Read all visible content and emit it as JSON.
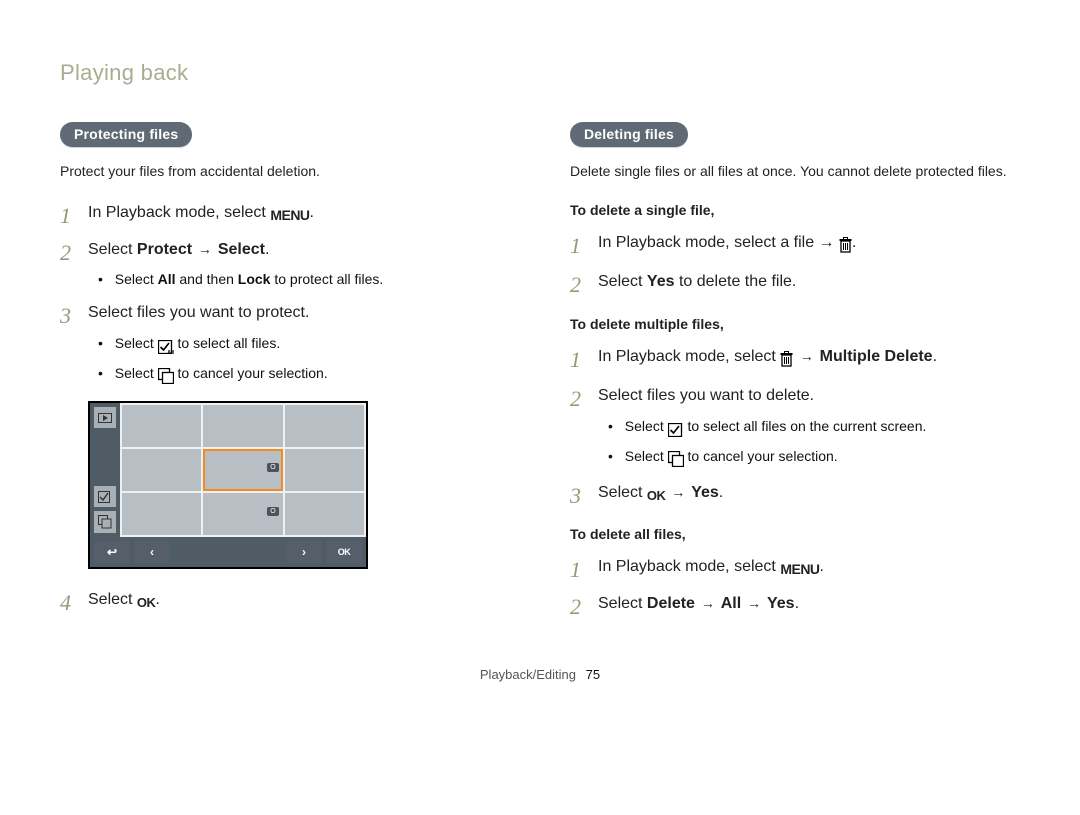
{
  "runningHead": "Playing back",
  "footer": {
    "section": "Playback/Editing",
    "page": "75"
  },
  "left": {
    "pill": "Protecting files",
    "intro": "Protect your files from accidental deletion.",
    "step1": "In Playback mode, select ",
    "step2_pre": "Select ",
    "step2_b1": "Protect",
    "step2_mid": " → ",
    "step2_b2": "Select",
    "step2_post": ".",
    "step2_sub_pre": "Select ",
    "step2_sub_b1": "All",
    "step2_sub_mid": " and then ",
    "step2_sub_b2": "Lock",
    "step2_sub_post": " to protect all files.",
    "step3": "Select files you want to protect.",
    "step3_sub1_pre": "Select ",
    "step3_sub1_post": " to select all files.",
    "step3_sub2_pre": "Select ",
    "step3_sub2_post": " to cancel your selection.",
    "step4_pre": "Select ",
    "step4_post": ".",
    "thumbKey": "O"
  },
  "right": {
    "pill": "Deleting files",
    "intro": "Delete single files or all files at once. You cannot delete protected files.",
    "hSingle": "To delete a single file,",
    "s1_step1_pre": "In Playback mode, select a file → ",
    "s1_step1_post": ".",
    "s1_step2_pre": "Select ",
    "s1_step2_b": "Yes",
    "s1_step2_post": " to delete the file.",
    "hMulti": "To delete multiple files,",
    "m_step1_pre": "In Playback mode, select ",
    "m_step1_mid": " → ",
    "m_step1_b": "Multiple Delete",
    "m_step1_post": ".",
    "m_step2": "Select files you want to delete.",
    "m_step2_sub1_pre": "Select ",
    "m_step2_sub1_post": " to select all files on the current screen.",
    "m_step2_sub2_pre": "Select ",
    "m_step2_sub2_post": " to cancel your selection.",
    "m_step3_pre": "Select ",
    "m_step3_mid": " → ",
    "m_step3_b": "Yes",
    "m_step3_post": ".",
    "hAll": "To delete all files,",
    "a_step1": "In Playback mode, select ",
    "a_step2_pre": "Select ",
    "a_step2_b1": "Delete",
    "a_step2_m1": " → ",
    "a_step2_b2": "All",
    "a_step2_m2": " → ",
    "a_step2_b3": "Yes",
    "a_step2_post": "."
  },
  "icons": {
    "menu": "MENU",
    "ok": "OK"
  }
}
